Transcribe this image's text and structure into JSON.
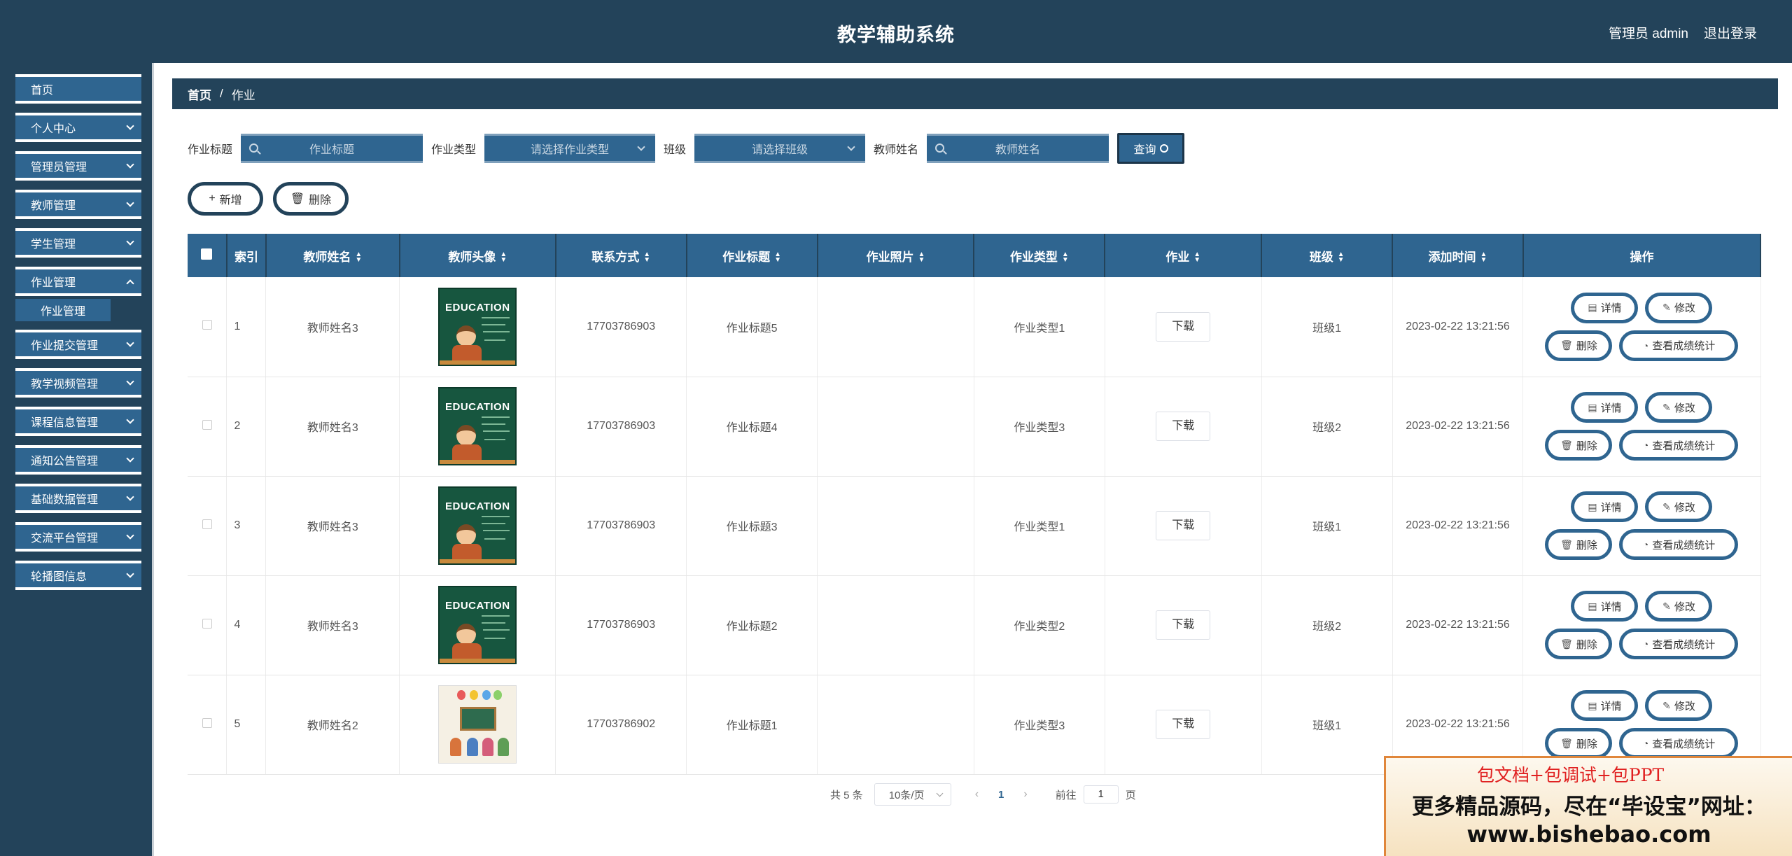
{
  "app": {
    "title": "教学辅助系统",
    "user_label": "管理员 admin",
    "logout_label": "退出登录"
  },
  "sidebar": {
    "items": [
      {
        "label": "首页",
        "has_children": false
      },
      {
        "label": "个人中心",
        "has_children": true
      },
      {
        "label": "管理员管理",
        "has_children": true
      },
      {
        "label": "教师管理",
        "has_children": true
      },
      {
        "label": "学生管理",
        "has_children": true
      },
      {
        "label": "作业管理",
        "has_children": true
      },
      {
        "label": "作业提交管理",
        "has_children": true
      },
      {
        "label": "教学视频管理",
        "has_children": true
      },
      {
        "label": "课程信息管理",
        "has_children": true
      },
      {
        "label": "通知公告管理",
        "has_children": true
      },
      {
        "label": "基础数据管理",
        "has_children": true
      },
      {
        "label": "交流平台管理",
        "has_children": true
      },
      {
        "label": "轮播图信息",
        "has_children": true
      }
    ],
    "active_subitem": "作业管理"
  },
  "breadcrumb": {
    "home": "首页",
    "separator": "/",
    "current": "作业"
  },
  "search": {
    "title_label": "作业标题",
    "title_placeholder": "作业标题",
    "type_label": "作业类型",
    "type_placeholder": "请选择作业类型",
    "class_label": "班级",
    "class_placeholder": "请选择班级",
    "teacher_label": "教师姓名",
    "teacher_placeholder": "教师姓名",
    "query_label": "查询"
  },
  "toolbar": {
    "add_label": "新增",
    "delete_label": "删除"
  },
  "table": {
    "columns": [
      "索引",
      "教师姓名",
      "教师头像",
      "联系方式",
      "作业标题",
      "作业照片",
      "作业类型",
      "作业",
      "班级",
      "添加时间",
      "操作"
    ],
    "rows": [
      {
        "index": "1",
        "teacher": "教师姓名3",
        "avatar": "education",
        "phone": "17703786903",
        "title": "作业标题5",
        "photo": "",
        "type": "作业类型1",
        "file": "下载",
        "class": "班级1",
        "time": "2023-02-22 13:21:56"
      },
      {
        "index": "2",
        "teacher": "教师姓名3",
        "avatar": "education",
        "phone": "17703786903",
        "title": "作业标题4",
        "photo": "",
        "type": "作业类型3",
        "file": "下载",
        "class": "班级2",
        "time": "2023-02-22 13:21:56"
      },
      {
        "index": "3",
        "teacher": "教师姓名3",
        "avatar": "education",
        "phone": "17703786903",
        "title": "作业标题3",
        "photo": "",
        "type": "作业类型1",
        "file": "下载",
        "class": "班级1",
        "time": "2023-02-22 13:21:56"
      },
      {
        "index": "4",
        "teacher": "教师姓名3",
        "avatar": "education",
        "phone": "17703786903",
        "title": "作业标题2",
        "photo": "",
        "type": "作业类型2",
        "file": "下载",
        "class": "班级2",
        "time": "2023-02-22 13:21:56"
      },
      {
        "index": "5",
        "teacher": "教师姓名2",
        "avatar": "classroom",
        "phone": "17703786902",
        "title": "作业标题1",
        "photo": "",
        "type": "作业类型3",
        "file": "下载",
        "class": "班级1",
        "time": "2023-02-22 13:21:56"
      }
    ],
    "actions": {
      "detail": "详情",
      "edit": "修改",
      "delete": "删除",
      "stats": "查看成绩统计"
    },
    "avatar_text": "EDUCATION"
  },
  "pagination": {
    "total_text": "共 5 条",
    "page_size": "10条/页",
    "current_page": "1",
    "goto_label": "前往",
    "goto_value": "1",
    "page_suffix": "页"
  },
  "banner": {
    "line1": "包文档+包调试+包PPT",
    "line2": "更多精品源码，尽在“毕设宝”网址：",
    "line3": "www.bishebao.com"
  },
  "colors": {
    "header_bg": "#23435a",
    "accent": "#2f6590"
  }
}
